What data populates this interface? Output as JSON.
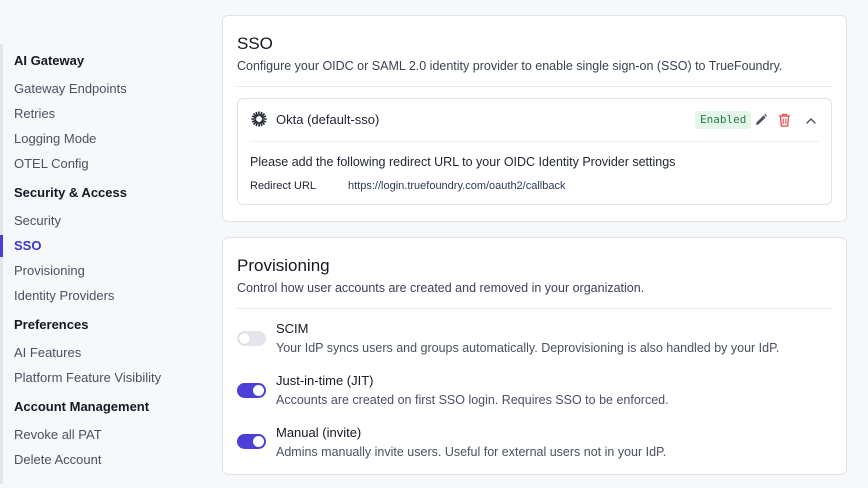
{
  "sidebar": {
    "sections": [
      {
        "heading": "AI Gateway",
        "items": [
          "Gateway Endpoints",
          "Retries",
          "Logging Mode",
          "OTEL Config"
        ]
      },
      {
        "heading": "Security & Access",
        "items": [
          "Security",
          "SSO",
          "Provisioning",
          "Identity Providers"
        ]
      },
      {
        "heading": "Preferences",
        "items": [
          "AI Features",
          "Platform Feature Visibility"
        ]
      },
      {
        "heading": "Account Management",
        "items": [
          "Revoke all PAT",
          "Delete Account"
        ]
      }
    ],
    "active_item": "SSO",
    "accent_color": "#4b3fd8"
  },
  "sso": {
    "title": "SSO",
    "subtitle": "Configure your OIDC or SAML 2.0 identity provider to enable single sign-on (SSO) to TrueFoundry.",
    "provider": {
      "icon": "okta-icon",
      "name": "Okta (default-sso)",
      "status": "Enabled",
      "redirect_message": "Please add the following redirect URL to your OIDC Identity Provider settings",
      "redirect_label": "Redirect URL",
      "redirect_url": "https://login.truefoundry.com/oauth2/callback"
    }
  },
  "provisioning": {
    "title": "Provisioning",
    "subtitle": "Control how user accounts are created and removed in your organization.",
    "options": [
      {
        "title": "SCIM",
        "description": "Your IdP syncs users and groups automatically. Deprovisioning is also handled by your IdP.",
        "enabled": false
      },
      {
        "title": "Just-in-time (JIT)",
        "description": "Accounts are created on first SSO login. Requires SSO to be enforced.",
        "enabled": true
      },
      {
        "title": "Manual (invite)",
        "description": "Admins manually invite users. Useful for external users not in your IdP.",
        "enabled": true
      }
    ]
  }
}
